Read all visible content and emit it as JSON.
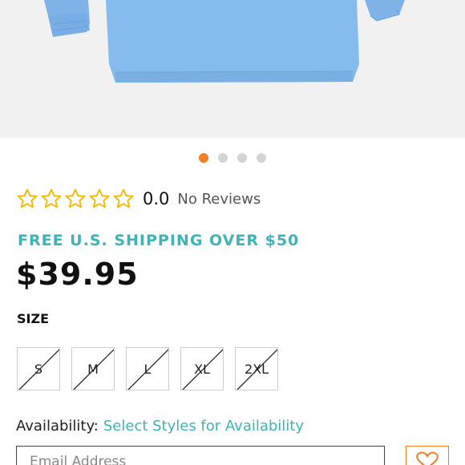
{
  "carousel": {
    "slide_count": 4,
    "active_index": 0,
    "colors": {
      "active": "#f07e26",
      "inactive": "#d4d4d4",
      "shirt": "#7fb3e8"
    }
  },
  "rating": {
    "star_count": 5,
    "value": "0.0",
    "reviews_text": "No Reviews",
    "star_color": "#f5b800"
  },
  "shipping_text": "FREE U.S. SHIPPING OVER $50",
  "price": "$39.95",
  "size": {
    "label": "SIZE",
    "options": [
      "S",
      "M",
      "L",
      "XL",
      "2XL"
    ]
  },
  "availability": {
    "label": "Availability:",
    "link": "Select Styles for Availability"
  },
  "email": {
    "placeholder": "Email Address"
  },
  "colors": {
    "accent_teal": "#3fb3b5",
    "accent_orange": "#f07e26"
  }
}
